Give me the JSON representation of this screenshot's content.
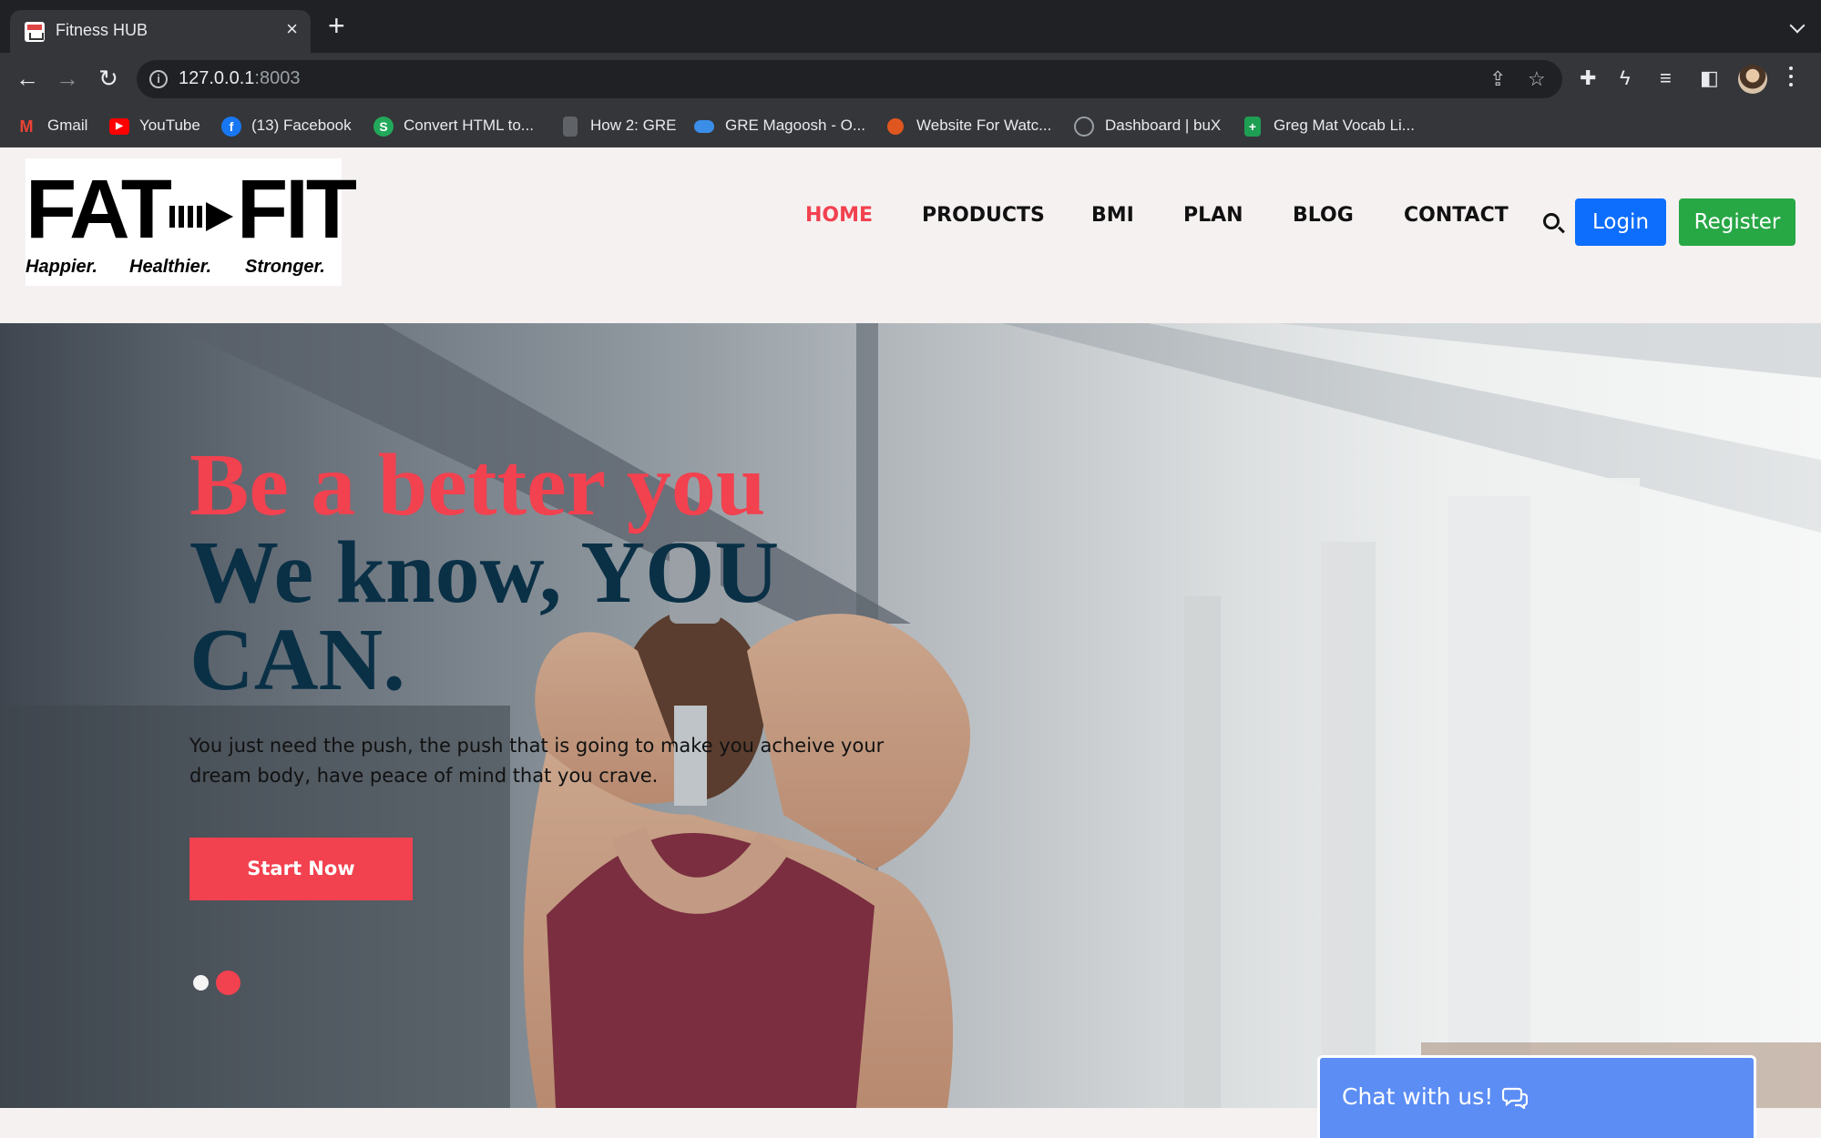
{
  "browser": {
    "tab_title": "Fitness HUB",
    "tab_close": "×",
    "new_tab": "+",
    "url_host": "127.0.0.1",
    "url_port": ":8003",
    "bookmarks": [
      {
        "label": "Gmail",
        "icon": "gmail-icon"
      },
      {
        "label": "YouTube",
        "icon": "youtube-icon"
      },
      {
        "label": "(13) Facebook",
        "icon": "facebook-icon"
      },
      {
        "label": "Convert HTML to...",
        "icon": "convert-html-icon"
      },
      {
        "label": "How 2: GRE",
        "icon": "document-icon"
      },
      {
        "label": "GRE Magoosh - O...",
        "icon": "cloud-icon"
      },
      {
        "label": "Website For Watc...",
        "icon": "website-icon"
      },
      {
        "label": "Dashboard | buX",
        "icon": "dashboard-icon"
      },
      {
        "label": "Greg Mat Vocab Li...",
        "icon": "sheets-icon"
      }
    ]
  },
  "site": {
    "logo": {
      "word1": "FAT",
      "word2": "FIT",
      "taglines": [
        "Happier.",
        "Healthier.",
        "Stronger."
      ]
    },
    "nav": [
      {
        "label": "HOME",
        "active": true
      },
      {
        "label": "PRODUCTS",
        "active": false
      },
      {
        "label": "BMI",
        "active": false
      },
      {
        "label": "PLAN",
        "active": false
      },
      {
        "label": "BLOG",
        "active": false
      },
      {
        "label": "CONTACT",
        "active": false
      }
    ],
    "login_label": "Login",
    "register_label": "Register"
  },
  "hero": {
    "line1": "Be a better you",
    "line2": "We know, YOU",
    "line3": "CAN.",
    "subtitle": "You just need the push, the push that is going to make you acheive your dream body, have peace of mind that you crave.",
    "cta_label": "Start Now",
    "carousel_total": 2,
    "carousel_active": 2
  },
  "chat": {
    "label": "Chat with us!"
  },
  "colors": {
    "accent_red": "#f2414f",
    "heading_navy": "#0a3046",
    "login_blue": "#0d6efd",
    "register_green": "#28a745",
    "chat_blue": "#5b8df5"
  }
}
